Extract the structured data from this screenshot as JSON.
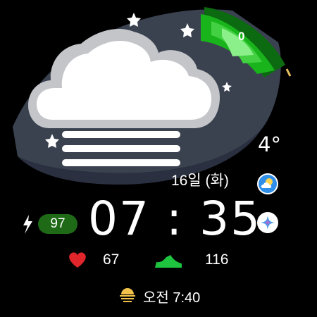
{
  "watch": {
    "activity_ring_value": "0",
    "temperature": "4°",
    "date": "16일 (화)",
    "time": "07 : 35",
    "battery": "97",
    "heart_rate": "67",
    "steps": "116",
    "sunrise": "오전 7:40"
  },
  "colors": {
    "background": "#000000",
    "panel": "#3a4250",
    "ring_green": "#19b41b",
    "battery_badge": "#1e6a17",
    "heart": "#e0262b",
    "shoe": "#1ec33f",
    "accent_blue": "#3aa0f0"
  },
  "icons": {
    "weather": "cloud-fog-icon",
    "charging": "lightning-bolt-icon",
    "heart": "heart-icon",
    "steps": "shoe-icon",
    "sunrise": "sunrise-icon",
    "weather_app": "weather-app-icon",
    "bixby_app": "sparkle-app-icon"
  }
}
